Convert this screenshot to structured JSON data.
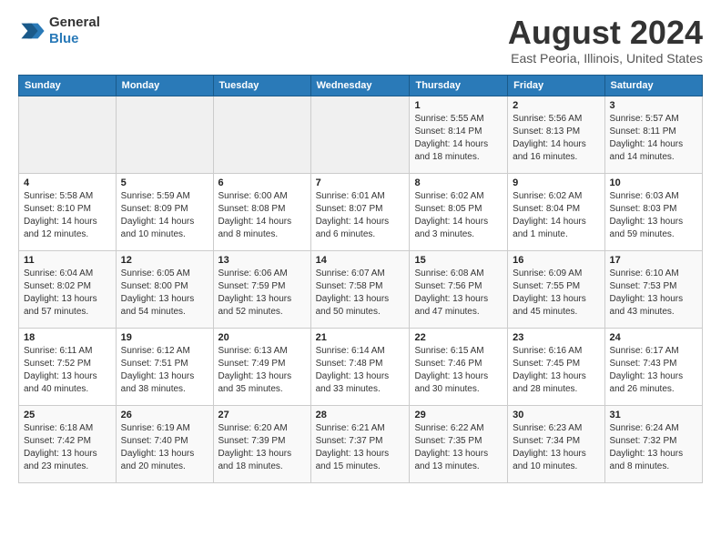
{
  "header": {
    "logo_line1": "General",
    "logo_line2": "Blue",
    "title": "August 2024",
    "subtitle": "East Peoria, Illinois, United States"
  },
  "weekdays": [
    "Sunday",
    "Monday",
    "Tuesday",
    "Wednesday",
    "Thursday",
    "Friday",
    "Saturday"
  ],
  "weeks": [
    [
      {
        "day": "",
        "info": ""
      },
      {
        "day": "",
        "info": ""
      },
      {
        "day": "",
        "info": ""
      },
      {
        "day": "",
        "info": ""
      },
      {
        "day": "1",
        "info": "Sunrise: 5:55 AM\nSunset: 8:14 PM\nDaylight: 14 hours\nand 18 minutes."
      },
      {
        "day": "2",
        "info": "Sunrise: 5:56 AM\nSunset: 8:13 PM\nDaylight: 14 hours\nand 16 minutes."
      },
      {
        "day": "3",
        "info": "Sunrise: 5:57 AM\nSunset: 8:11 PM\nDaylight: 14 hours\nand 14 minutes."
      }
    ],
    [
      {
        "day": "4",
        "info": "Sunrise: 5:58 AM\nSunset: 8:10 PM\nDaylight: 14 hours\nand 12 minutes."
      },
      {
        "day": "5",
        "info": "Sunrise: 5:59 AM\nSunset: 8:09 PM\nDaylight: 14 hours\nand 10 minutes."
      },
      {
        "day": "6",
        "info": "Sunrise: 6:00 AM\nSunset: 8:08 PM\nDaylight: 14 hours\nand 8 minutes."
      },
      {
        "day": "7",
        "info": "Sunrise: 6:01 AM\nSunset: 8:07 PM\nDaylight: 14 hours\nand 6 minutes."
      },
      {
        "day": "8",
        "info": "Sunrise: 6:02 AM\nSunset: 8:05 PM\nDaylight: 14 hours\nand 3 minutes."
      },
      {
        "day": "9",
        "info": "Sunrise: 6:02 AM\nSunset: 8:04 PM\nDaylight: 14 hours\nand 1 minute."
      },
      {
        "day": "10",
        "info": "Sunrise: 6:03 AM\nSunset: 8:03 PM\nDaylight: 13 hours\nand 59 minutes."
      }
    ],
    [
      {
        "day": "11",
        "info": "Sunrise: 6:04 AM\nSunset: 8:02 PM\nDaylight: 13 hours\nand 57 minutes."
      },
      {
        "day": "12",
        "info": "Sunrise: 6:05 AM\nSunset: 8:00 PM\nDaylight: 13 hours\nand 54 minutes."
      },
      {
        "day": "13",
        "info": "Sunrise: 6:06 AM\nSunset: 7:59 PM\nDaylight: 13 hours\nand 52 minutes."
      },
      {
        "day": "14",
        "info": "Sunrise: 6:07 AM\nSunset: 7:58 PM\nDaylight: 13 hours\nand 50 minutes."
      },
      {
        "day": "15",
        "info": "Sunrise: 6:08 AM\nSunset: 7:56 PM\nDaylight: 13 hours\nand 47 minutes."
      },
      {
        "day": "16",
        "info": "Sunrise: 6:09 AM\nSunset: 7:55 PM\nDaylight: 13 hours\nand 45 minutes."
      },
      {
        "day": "17",
        "info": "Sunrise: 6:10 AM\nSunset: 7:53 PM\nDaylight: 13 hours\nand 43 minutes."
      }
    ],
    [
      {
        "day": "18",
        "info": "Sunrise: 6:11 AM\nSunset: 7:52 PM\nDaylight: 13 hours\nand 40 minutes."
      },
      {
        "day": "19",
        "info": "Sunrise: 6:12 AM\nSunset: 7:51 PM\nDaylight: 13 hours\nand 38 minutes."
      },
      {
        "day": "20",
        "info": "Sunrise: 6:13 AM\nSunset: 7:49 PM\nDaylight: 13 hours\nand 35 minutes."
      },
      {
        "day": "21",
        "info": "Sunrise: 6:14 AM\nSunset: 7:48 PM\nDaylight: 13 hours\nand 33 minutes."
      },
      {
        "day": "22",
        "info": "Sunrise: 6:15 AM\nSunset: 7:46 PM\nDaylight: 13 hours\nand 30 minutes."
      },
      {
        "day": "23",
        "info": "Sunrise: 6:16 AM\nSunset: 7:45 PM\nDaylight: 13 hours\nand 28 minutes."
      },
      {
        "day": "24",
        "info": "Sunrise: 6:17 AM\nSunset: 7:43 PM\nDaylight: 13 hours\nand 26 minutes."
      }
    ],
    [
      {
        "day": "25",
        "info": "Sunrise: 6:18 AM\nSunset: 7:42 PM\nDaylight: 13 hours\nand 23 minutes."
      },
      {
        "day": "26",
        "info": "Sunrise: 6:19 AM\nSunset: 7:40 PM\nDaylight: 13 hours\nand 20 minutes."
      },
      {
        "day": "27",
        "info": "Sunrise: 6:20 AM\nSunset: 7:39 PM\nDaylight: 13 hours\nand 18 minutes."
      },
      {
        "day": "28",
        "info": "Sunrise: 6:21 AM\nSunset: 7:37 PM\nDaylight: 13 hours\nand 15 minutes."
      },
      {
        "day": "29",
        "info": "Sunrise: 6:22 AM\nSunset: 7:35 PM\nDaylight: 13 hours\nand 13 minutes."
      },
      {
        "day": "30",
        "info": "Sunrise: 6:23 AM\nSunset: 7:34 PM\nDaylight: 13 hours\nand 10 minutes."
      },
      {
        "day": "31",
        "info": "Sunrise: 6:24 AM\nSunset: 7:32 PM\nDaylight: 13 hours\nand 8 minutes."
      }
    ]
  ]
}
